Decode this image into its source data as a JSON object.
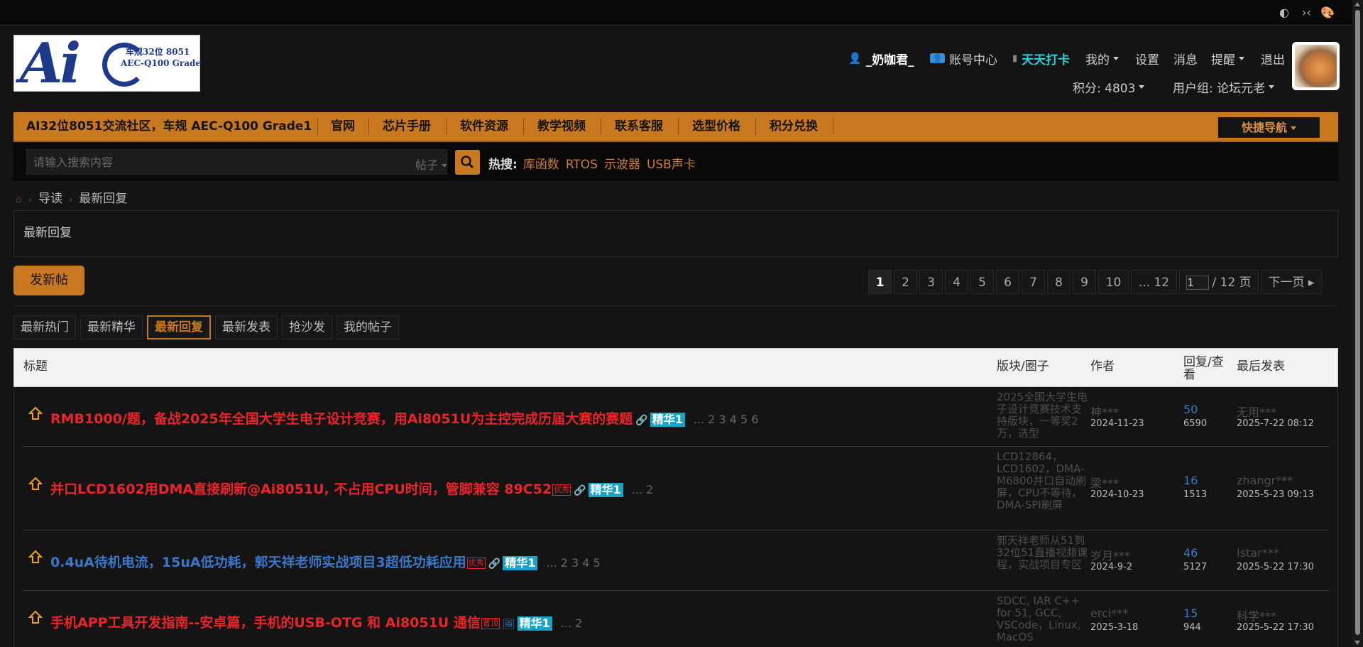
{
  "logo": {
    "line1": "车规32位 8051",
    "line2": "AEC-Q100 Grade1",
    "letters": "Ai"
  },
  "user": {
    "name": "_奶咖君_",
    "account_center": "账号中心",
    "checkin": "天天打卡",
    "mine": "我的",
    "settings": "设置",
    "messages": "消息",
    "alerts": "提醒",
    "logout": "退出",
    "points": "积分: 4803",
    "group": "用户组: 论坛元老"
  },
  "nav": {
    "items": [
      "AI32位8051交流社区，车规 AEC-Q100 Grade1",
      "官网",
      "芯片手册",
      "软件资源",
      "教学视频",
      "联系客服",
      "选型价格",
      "积分兑换"
    ],
    "quick": "快捷导航"
  },
  "search": {
    "placeholder": "请输入搜索内容",
    "type": "帖子",
    "hot_label": "热搜:",
    "hot": [
      "库函数",
      "RTOS",
      "示波器",
      "USB声卡"
    ]
  },
  "breadcrumb": [
    "导读",
    "最新回复"
  ],
  "section_title": "最新回复",
  "new_post": "发新帖",
  "pager": {
    "pages": [
      "1",
      "2",
      "3",
      "4",
      "5",
      "6",
      "7",
      "8",
      "9",
      "10",
      "... 12"
    ],
    "input": "1",
    "total": "/ 12 页",
    "next": "下一页"
  },
  "tabs": [
    "最新热门",
    "最新精华",
    "最新回复",
    "最新发表",
    "抢沙发",
    "我的帖子"
  ],
  "columns": {
    "title": "标题",
    "forum": "版块/圈子",
    "author": "作者",
    "replies": "回复/查看",
    "last": "最后发表"
  },
  "threads": [
    {
      "title": "RMB1000/题，备战2025年全国大学生电子设计竞赛，用Ai8051U为主控完成历届大赛的赛题",
      "badge": "",
      "digest": "精华1",
      "pages": "... 2 3 4 5 6",
      "forum": "2025全国大学生电子设计竞赛技术支持版块，一等奖2万，选型",
      "author": "神***",
      "date": "2024-11-23",
      "replies": "50",
      "views": "6590",
      "last_user": "无用***",
      "last_time": "2025-7-22 08:12",
      "color": "#e8252b",
      "attach": "🔗"
    },
    {
      "title": "并口LCD1602用DMA直接刷新@Ai8051U, 不占用CPU时间，管脚兼容 89C52",
      "badge": "优秀",
      "digest": "精华1",
      "pages": "... 2",
      "forum": "LCD12864，LCD1602，DMA-M6800并口自动刷屏，CPU不等待，DMA-SPI刷屏",
      "author": "梁***",
      "date": "2024-10-23",
      "replies": "16",
      "views": "1513",
      "last_user": "zhangr***",
      "last_time": "2025-5-23 09:13",
      "color": "#e8252b",
      "attach": "🔗"
    },
    {
      "title": "0.4uA待机电流，15uA低功耗，郭天祥老师实战项目3超低功耗应用",
      "badge": "优秀",
      "digest": "精华1",
      "pages": "... 2 3 4 5",
      "forum": "郭天祥老师从51到32位51直播视频课程，实战项目专区",
      "author": "岁月***",
      "date": "2024-9-2",
      "replies": "46",
      "views": "5127",
      "last_user": "Istar***",
      "last_time": "2025-5-22 17:30",
      "color": "#3b77c8",
      "attach": "🔗"
    },
    {
      "title": "手机APP工具开发指南--安卓篇，手机的USB-OTG 和 Ai8051U 通信",
      "badge": "置顶",
      "digest": "精华1",
      "pages": "... 2",
      "forum": "SDCC, IAR C++ for 51, GCC, VSCode，Linux, MacOS",
      "author": "erci***",
      "date": "2025-3-18",
      "replies": "15",
      "views": "944",
      "last_user": "科学***",
      "last_time": "2025-5-22 17:30",
      "color": "#e8252b",
      "attach": "🖼"
    }
  ]
}
